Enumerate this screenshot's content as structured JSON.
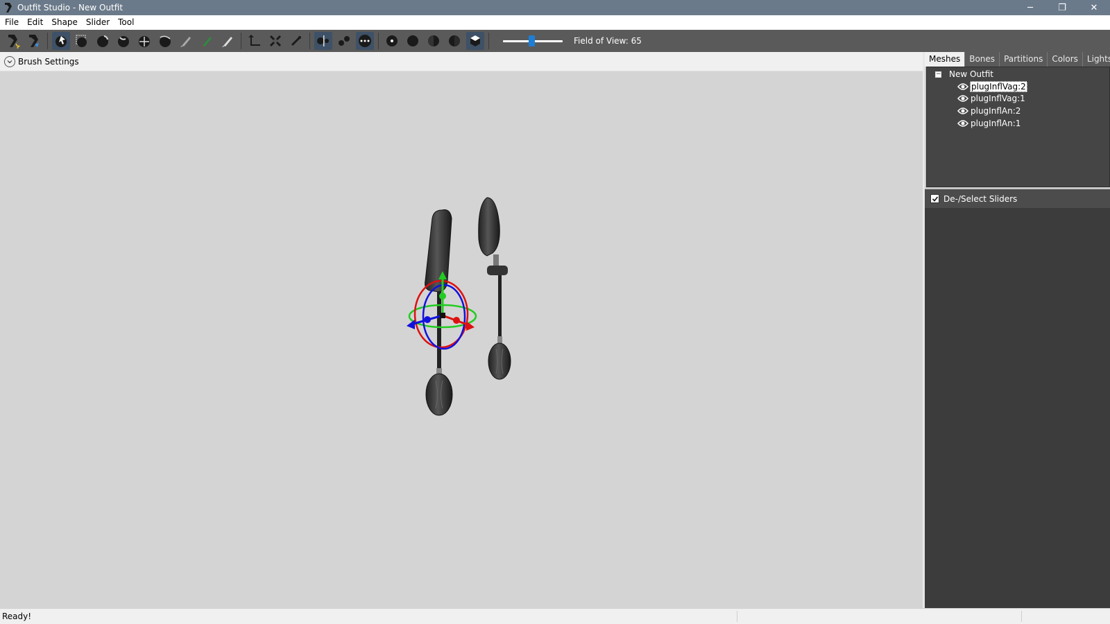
{
  "window": {
    "title": "Outfit Studio - New Outfit",
    "minimize": "─",
    "restore": "❐",
    "close": "✕"
  },
  "menu": {
    "items": [
      "File",
      "Edit",
      "Shape",
      "Slider",
      "Tool"
    ]
  },
  "toolbar": {
    "fov_label": "Field of View: 65",
    "fov_value": 65
  },
  "brush_settings": {
    "label": "Brush Settings"
  },
  "right_panel": {
    "tabs": [
      "Meshes",
      "Bones",
      "Partitions",
      "Colors",
      "Lights"
    ],
    "active_tab": "Meshes",
    "tree": {
      "root": "New Outfit",
      "items": [
        "plugInflVag:2",
        "plugInflVag:1",
        "plugInflAn:2",
        "plugInflAn:1"
      ],
      "selected": "plugInflVag:2"
    },
    "sliders_header": "De-/Select Sliders"
  },
  "status": {
    "text": "Ready!"
  },
  "colors": {
    "titlebar": "#6b7a8a",
    "toolbar": "#5a5a5a",
    "accent": "#1e7ed6",
    "viewport": "#d4d4d4",
    "panel_dark": "#3c3c3c"
  }
}
